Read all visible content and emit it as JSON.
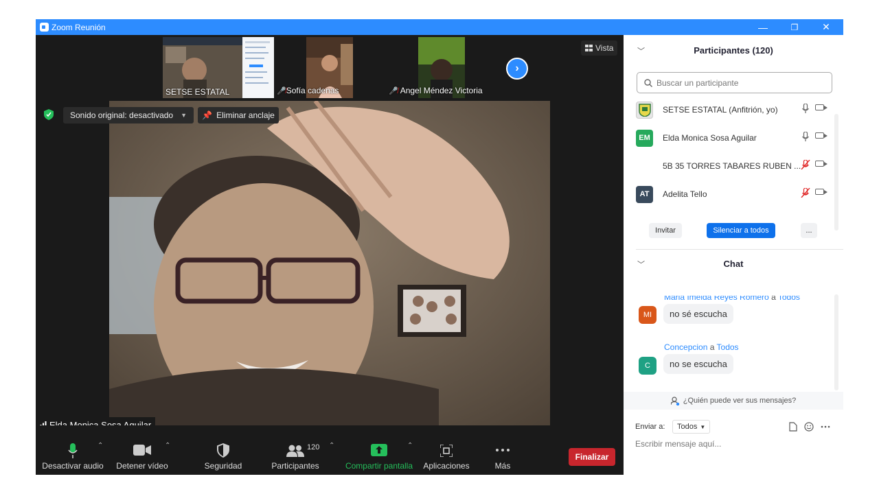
{
  "window": {
    "title": "Zoom Reunión",
    "minimize": "—",
    "restore": "❐",
    "close": "✕"
  },
  "thumbnails": [
    {
      "name": "SETSE ESTATAL",
      "muted": false
    },
    {
      "name": "Sofía cadenas",
      "muted": true
    },
    {
      "name": "Angel Méndez Victoria",
      "muted": true
    }
  ],
  "view_button": "Vista",
  "video_controls": {
    "original_sound": "Sonido original: desactivado",
    "unpin": "Eliminar anclaje"
  },
  "active_speaker": "Elda Monica Sosa Aguilar",
  "toolbar": {
    "audio": "Desactivar audio",
    "video": "Detener vídeo",
    "security": "Seguridad",
    "participants": "Participantes",
    "participants_count": "120",
    "share": "Compartir pantalla",
    "apps": "Aplicaciones",
    "more": "Más",
    "end": "Finalizar"
  },
  "participants_panel": {
    "title": "Participantes (120)",
    "search_placeholder": "Buscar un participante",
    "list": [
      {
        "initials": "",
        "name": "SETSE ESTATAL (Anfitrión, yo)",
        "avatar_color": "#e6e6e6",
        "mic_muted": false
      },
      {
        "initials": "EM",
        "name": "Elda Monica Sosa Aguilar",
        "avatar_color": "#26a95c",
        "mic_muted": false
      },
      {
        "initials": "",
        "name": "5B 35 TORRES TABARES RUBEN ...",
        "avatar_color": "#ffffff",
        "mic_muted": true
      },
      {
        "initials": "AT",
        "name": "Adelita Tello",
        "avatar_color": "#394a5c",
        "mic_muted": true
      }
    ],
    "invite": "Invitar",
    "mute_all": "Silenciar a todos",
    "more": "..."
  },
  "chat_panel": {
    "title": "Chat",
    "messages": [
      {
        "initials": "MI",
        "sender": "Maria Imelda Reyes Romero",
        "to_word": "a",
        "recipient": "Todos",
        "text": "no sé  escucha",
        "avatar_color": "#d9571a"
      },
      {
        "initials": "C",
        "sender": "Concepcion",
        "to_word": "a",
        "recipient": "Todos",
        "text": "no se escucha",
        "avatar_color": "#1fa184"
      }
    ],
    "who_sees": "¿Quién puede ver sus mensajes?",
    "send_to_label": "Enviar a:",
    "send_to_value": "Todos",
    "input_placeholder": "Escribir mensaje aquí..."
  },
  "colors": {
    "zoom_blue": "#2d8cff",
    "end_red": "#c8262d",
    "share_green": "#25bf5b",
    "muted_red": "#e02828"
  }
}
